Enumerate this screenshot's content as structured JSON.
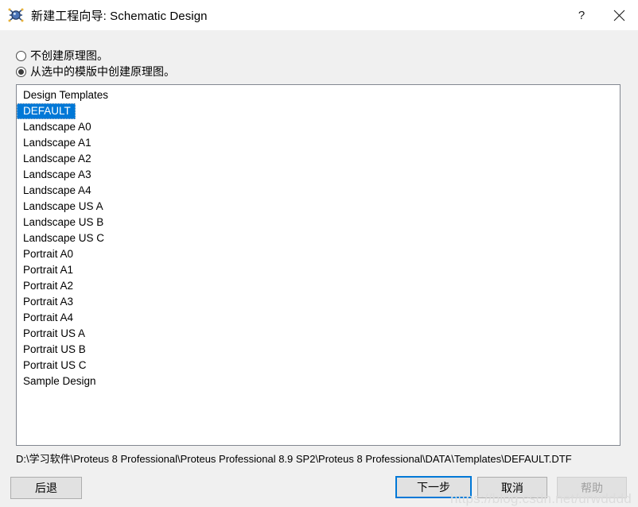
{
  "window": {
    "title": "新建工程向导: Schematic Design",
    "icon": "proteus-logo-icon",
    "help_button": "?",
    "close_button": "✕"
  },
  "options": [
    {
      "label": "不创建原理图。",
      "selected": false
    },
    {
      "label": "从选中的模版中创建原理图。",
      "selected": true
    }
  ],
  "template_list": {
    "header": "Design Templates",
    "items": [
      "DEFAULT",
      "Landscape A0",
      "Landscape A1",
      "Landscape A2",
      "Landscape A3",
      "Landscape A4",
      "Landscape US A",
      "Landscape US B",
      "Landscape US C",
      "Portrait A0",
      "Portrait A1",
      "Portrait A2",
      "Portrait A3",
      "Portrait A4",
      "Portrait US A",
      "Portrait US B",
      "Portrait US C",
      "Sample Design"
    ],
    "selected_index": 0,
    "selection_bg": "#0078d7",
    "selection_fg": "#ffffff"
  },
  "path": "D:\\学习软件\\Proteus 8 Professional\\Proteus Professional 8.9 SP2\\Proteus 8 Professional\\DATA\\Templates\\DEFAULT.DTF",
  "buttons": {
    "back": "后退",
    "next": "下一步",
    "cancel": "取消",
    "help": "帮助",
    "help_disabled": true,
    "default_button": "next",
    "accent": "#0078d7"
  },
  "watermark": "https://blog.csdn.net/urwdddd"
}
